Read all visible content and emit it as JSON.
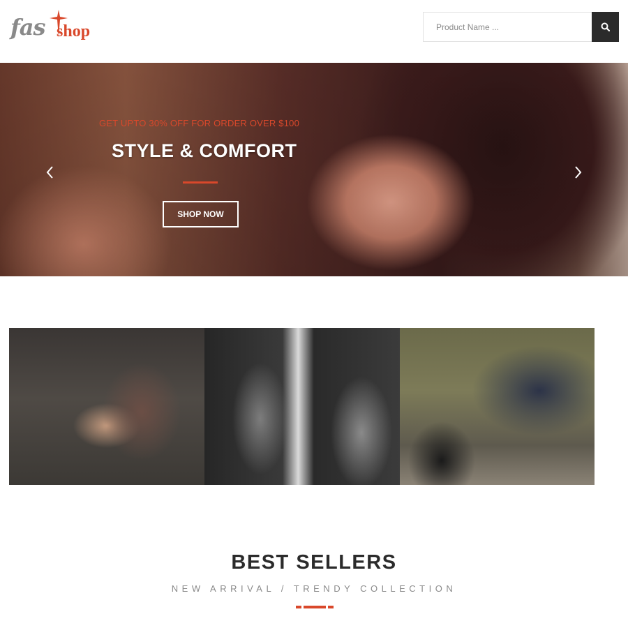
{
  "brand": {
    "logo_part1": "fas",
    "logo_part2": "shop",
    "logo_color": "#d9482b"
  },
  "search": {
    "placeholder": "Product Name ...",
    "value": "",
    "icon": "search-icon"
  },
  "hero": {
    "promo": "GET UPTO 30% OFF FOR ORDER OVER $100",
    "title": "STYLE & COMFORT",
    "button_label": "SHOP NOW",
    "prev_icon": "chevron-left-icon",
    "next_icon": "chevron-right-icon"
  },
  "banners": [
    {
      "name": "banner-fur-coat"
    },
    {
      "name": "banner-patterned-jackets"
    },
    {
      "name": "banner-boots-shoes"
    }
  ],
  "best_sellers": {
    "title": "BEST SELLERS",
    "subtitle": "NEW ARRIVAL / TRENDY COLLECTION"
  },
  "colors": {
    "accent": "#d9482b",
    "dark": "#2b2b2b",
    "muted": "#8a8a8a"
  }
}
